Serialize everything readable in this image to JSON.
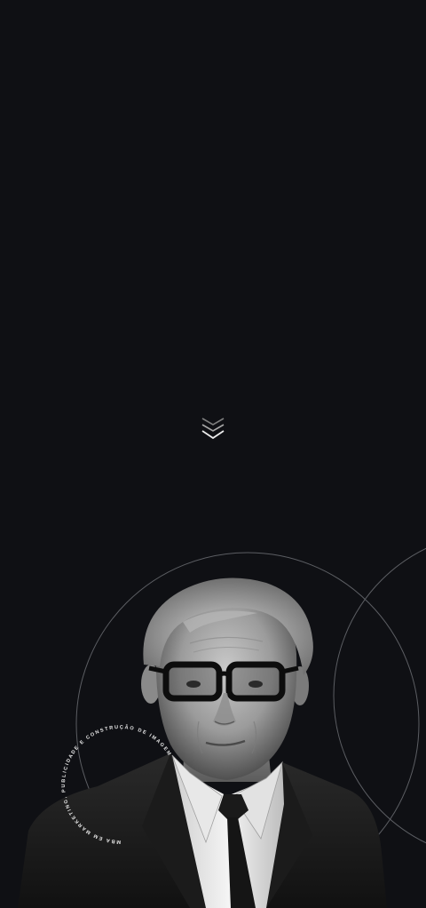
{
  "hero": {
    "scroll_icon": "triple-chevron-down-icon"
  },
  "badge": {
    "text": "MBA EM MARKETING, PUBLICIDADE E CONSTRUÇÃO DE IMAGEM"
  },
  "portrait": {
    "subject": "elderly-man-with-black-glasses"
  },
  "colors": {
    "background": "#0f1014",
    "circle_stroke": "#6b6d73",
    "chevron": "#d9d9d9"
  }
}
